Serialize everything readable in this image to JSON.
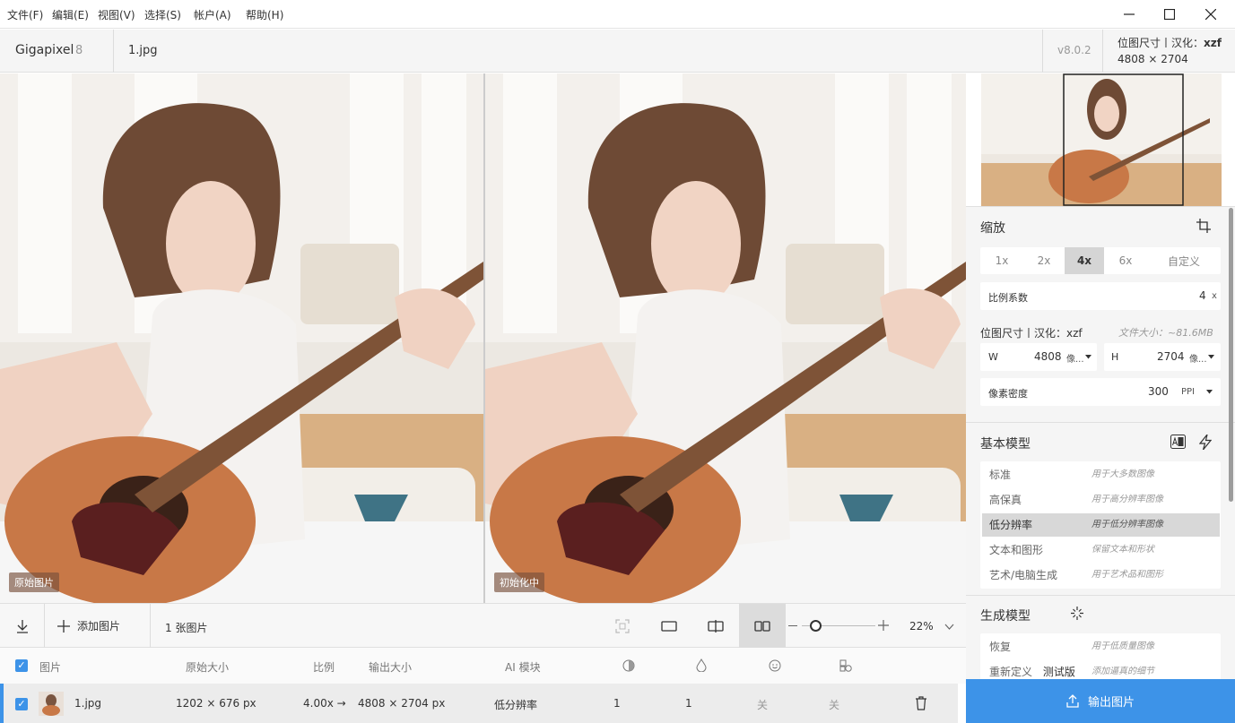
{
  "menu": [
    "文件(F)",
    "编辑(E)",
    "视图(V)",
    "选择(S)",
    "帐户(A)",
    "帮助(H)"
  ],
  "app": {
    "name": "Gigapixel",
    "version_major": "8",
    "filename": "1.jpg",
    "version": "v8.0.2",
    "dim_label": "位图尺寸丨汉化：",
    "dim_author": "xzf",
    "dims": "4808 × 2704"
  },
  "viewer": {
    "left_label": "原始图片",
    "right_label": "初始化中"
  },
  "toolbar": {
    "add_label": "添加图片",
    "count_label": "1 张图片",
    "zoom": "22%",
    "zoom_fraction": 0.18
  },
  "table": {
    "headers": [
      "图片",
      "原始大小",
      "比例",
      "输出大小",
      "AI 模块"
    ],
    "row": {
      "name": "1.jpg",
      "orig": "1202 × 676 px",
      "scale": "4.00x →",
      "output": "4808 × 2704 px",
      "model": "低分辨率",
      "c1": "1",
      "c2": "1",
      "c3": "关",
      "c4": "关"
    }
  },
  "panel": {
    "scale_title": "缩放",
    "scale_options": [
      "1x",
      "2x",
      "4x",
      "6x",
      "自定义"
    ],
    "scale_active": 2,
    "factor_label": "比例系数",
    "factor_value": "4",
    "factor_unit": "x",
    "size_label": "位图尺寸丨汉化：xzf",
    "size_hint": "文件大小：~81.6MB",
    "w_label": "W",
    "w_value": "4808",
    "w_unit": "像...",
    "h_label": "H",
    "h_value": "2704",
    "h_unit": "像...",
    "density_label": "像素密度",
    "density_value": "300",
    "density_unit": "PPI",
    "base_title": "基本模型",
    "models": [
      {
        "name": "标准",
        "desc": "用于大多数图像"
      },
      {
        "name": "高保真",
        "desc": "用于高分辨率图像"
      },
      {
        "name": "低分辨率",
        "desc": "用于低分辨率图像"
      },
      {
        "name": "文本和图形",
        "desc": "保留文本和形状"
      },
      {
        "name": "艺术/电脑生成",
        "desc": "用于艺术品和图形"
      }
    ],
    "model_selected": 2,
    "gen_title": "生成模型",
    "gen_models": [
      {
        "name": "恢复",
        "tag": "",
        "desc": "用于低质量图像"
      },
      {
        "name": "重新定义",
        "tag": "测试版",
        "desc": "添加逼真的细节"
      }
    ],
    "export_label": "输出图片"
  },
  "colors": {
    "accent": "#3d93e8"
  }
}
